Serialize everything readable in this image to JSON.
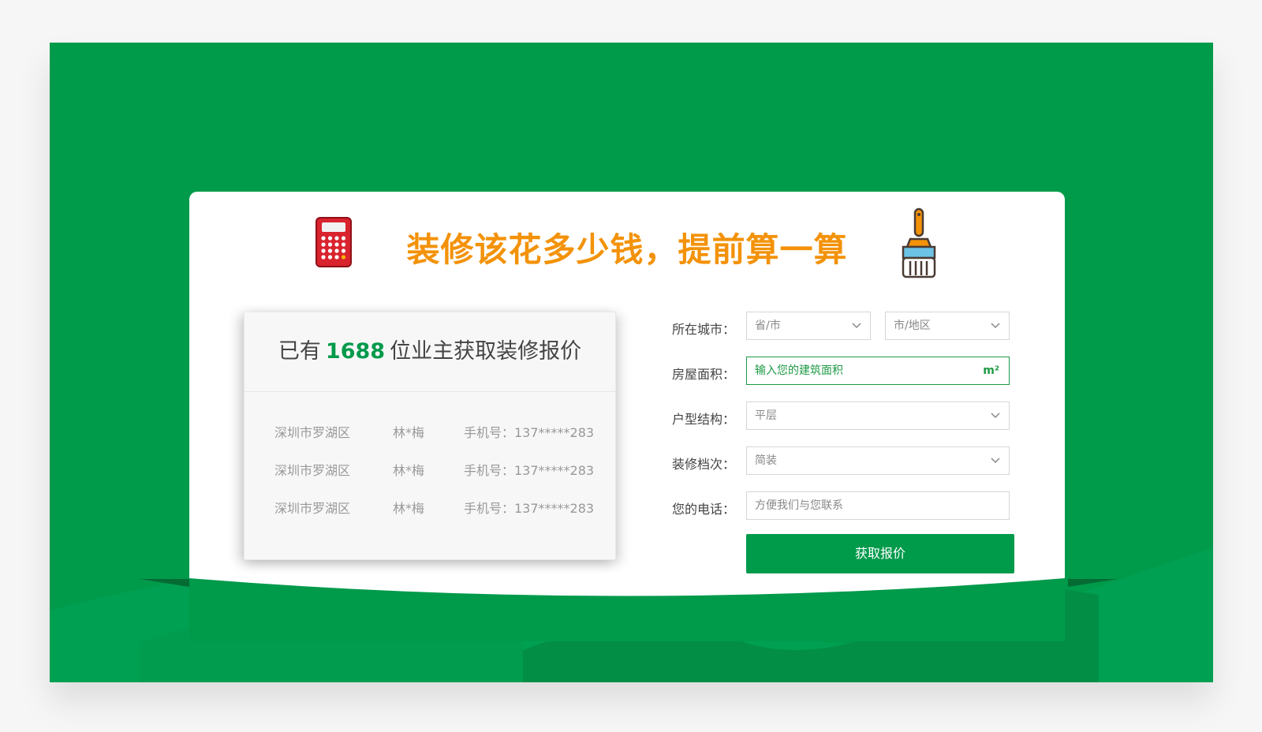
{
  "header": {
    "headline": "装修该花多少钱，提前算一算"
  },
  "stats": {
    "prefix": "已有",
    "count": "1688",
    "suffix": "位业主获取装修报价",
    "records": [
      {
        "district": "深圳市罗湖区",
        "name": "林*梅",
        "phone": "手机号：137*****283"
      },
      {
        "district": "深圳市罗湖区",
        "name": "林*梅",
        "phone": "手机号：137*****283"
      },
      {
        "district": "深圳市罗湖区",
        "name": "林*梅",
        "phone": "手机号：137*****283"
      }
    ]
  },
  "form": {
    "city_label": "所在城市：",
    "province_placeholder": "省/市",
    "district_placeholder": "市/地区",
    "area_label": "房屋面积：",
    "area_placeholder": "输入您的建筑面积",
    "area_unit": "m²",
    "layout_label": "户型结构：",
    "layout_value": "平层",
    "grade_label": "装修档次：",
    "grade_value": "简装",
    "phone_label": "您的电话：",
    "phone_placeholder": "方便我们与您联系",
    "submit_label": "获取报价"
  },
  "colors": {
    "brand_green": "#009a4b",
    "headline_orange": "#f39209"
  },
  "icons": {
    "left": "calculator-icon",
    "right": "paint-brush-icon",
    "select": "chevron-down-icon"
  }
}
